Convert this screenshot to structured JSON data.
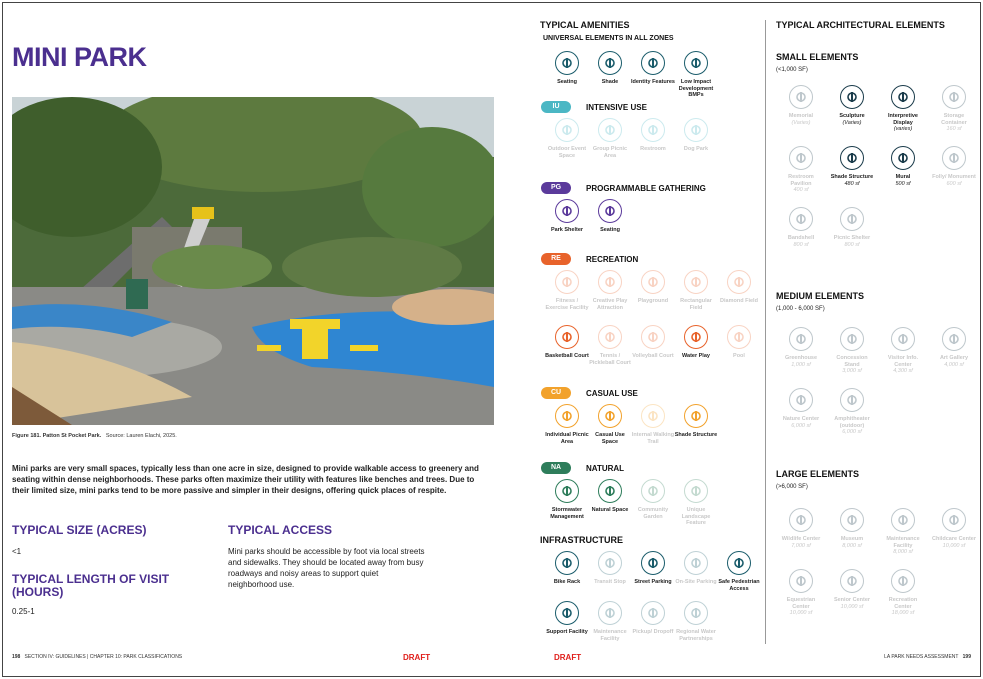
{
  "left": {
    "title": "MINI PARK",
    "caption_bold": "Figure 181.  Patton St Pocket Park.",
    "caption_src": "Source: Lauren Elachi, 2025.",
    "intro": "Mini parks are very small spaces, typically less than one acre in size, designed to provide walkable access to greenery and seating within dense neighborhoods. These parks often maximize their utility with features like benches and trees. Due to their limited size, mini parks tend to be more passive and simpler in their designs, offering quick places of respite.",
    "size_heading": "TYPICAL SIZE (ACRES)",
    "size_value": "<1",
    "visit_heading": "TYPICAL LENGTH OF VISIT (HOURS)",
    "visit_value": "0.25-1",
    "access_heading": "TYPICAL ACCESS",
    "access_text": "Mini parks should be accessible by foot via local streets and sidewalks. They should be located away from busy roadways and noisy areas to support quiet neighborhood use."
  },
  "footer": {
    "left_page": "198",
    "left_text": "SECTION IV: GUIDELINES  |  CHAPTER 10: PARK CLASSIFICATIONS",
    "draft": "DRAFT",
    "right_text": "LA PARK NEEDS ASSESSMENT",
    "right_page": "199"
  },
  "amenities": {
    "heading": "TYPICAL AMENITIES",
    "universal_heading": "UNIVERSAL ELEMENTS IN ALL ZONES",
    "universal_color": "#1a5c6b",
    "universal": [
      {
        "label": "Seating",
        "icon": "bench-icon",
        "active": true
      },
      {
        "label": "Shade",
        "icon": "tree-icon",
        "active": true
      },
      {
        "label": "Identity Features",
        "icon": "badge-icon",
        "active": true
      },
      {
        "label": "Low Impact Development BMPs",
        "icon": "leaf-water-icon",
        "active": true
      }
    ],
    "zones": [
      {
        "code": "IU",
        "name": "INTENSIVE USE",
        "color": "#4bb7c4",
        "items": [
          {
            "label": "Outdoor Event Space",
            "active": false
          },
          {
            "label": "Group Picnic Area",
            "active": false
          },
          {
            "label": "Restroom",
            "active": false
          },
          {
            "label": "Dog Park",
            "active": false
          }
        ]
      },
      {
        "code": "PG",
        "name": "PROGRAMMABLE GATHERING",
        "color": "#5b3a9b",
        "items": [
          {
            "label": "Park Shelter",
            "active": true
          },
          {
            "label": "Seating",
            "active": true
          }
        ]
      },
      {
        "code": "RE",
        "name": "RECREATION",
        "color": "#e8632b",
        "items": [
          {
            "label": "Fitness / Exercise Facility",
            "active": false
          },
          {
            "label": "Creative Play Attraction",
            "active": false
          },
          {
            "label": "Playground",
            "active": false
          },
          {
            "label": "Rectangular Field",
            "active": false
          },
          {
            "label": "Diamond Field",
            "active": false
          },
          {
            "label": "Basketball Court",
            "active": true
          },
          {
            "label": "Tennis / Pickleball Court",
            "active": false
          },
          {
            "label": "Volleyball Court",
            "active": false
          },
          {
            "label": "Water Play",
            "active": true
          },
          {
            "label": "Pool",
            "active": false
          }
        ]
      },
      {
        "code": "CU",
        "name": "CASUAL USE",
        "color": "#f2a22c",
        "items": [
          {
            "label": "Individual Picnic Area",
            "active": true
          },
          {
            "label": "Casual Use Space",
            "active": true
          },
          {
            "label": "Internal Walking Trail",
            "active": false
          },
          {
            "label": "Shade Structure",
            "active": true
          }
        ]
      },
      {
        "code": "NA",
        "name": "NATURAL",
        "color": "#2e7d5b",
        "items": [
          {
            "label": "Stormwater Management",
            "active": true
          },
          {
            "label": "Natural Space",
            "active": true
          },
          {
            "label": "Community Garden",
            "active": false
          },
          {
            "label": "Unique Landscape Feature",
            "active": false
          }
        ]
      }
    ],
    "infra_heading": "INFRASTRUCTURE",
    "infra_color": "#1a5c6b",
    "infrastructure": [
      {
        "label": "Bike Rack",
        "active": true
      },
      {
        "label": "Transit Stop",
        "active": false
      },
      {
        "label": "Street Parking",
        "active": true
      },
      {
        "label": "On-Site Parking",
        "active": false
      },
      {
        "label": "Safe Pedestrian Access",
        "active": true
      },
      {
        "label": "Support Facility",
        "active": true
      },
      {
        "label": "Maintenance Facility",
        "active": false
      },
      {
        "label": "Pickup/ Dropoff",
        "active": false
      },
      {
        "label": "Regional Water Partnerships",
        "active": false
      }
    ]
  },
  "architecture": {
    "heading": "TYPICAL ARCHITECTURAL ELEMENTS",
    "color": "#1a3b4a",
    "small": {
      "heading": "SMALL ELEMENTS",
      "range": "(<1,000 SF)",
      "items": [
        {
          "label": "Memorial",
          "size": "(Varies)",
          "active": false
        },
        {
          "label": "Sculpture",
          "size": "(Varies)",
          "active": true
        },
        {
          "label": "Interpretive Display",
          "size": "(varies)",
          "active": true
        },
        {
          "label": "Storage Container",
          "size": "160 sf",
          "active": false
        },
        {
          "label": "Restroom Pavilion",
          "size": "400 sf",
          "active": false
        },
        {
          "label": "Shade Structure",
          "size": "480 sf",
          "active": true
        },
        {
          "label": "Mural",
          "size": "500 sf",
          "active": true
        },
        {
          "label": "Folly/ Monument",
          "size": "600 sf",
          "active": false
        },
        {
          "label": "Bandshell",
          "size": "800 sf",
          "active": false
        },
        {
          "label": "Picnic Shelter",
          "size": "800 sf",
          "active": false
        }
      ]
    },
    "medium": {
      "heading": "MEDIUM ELEMENTS",
      "range": "(1,000 - 6,000 SF)",
      "items": [
        {
          "label": "Greenhouse",
          "size": "1,000 sf",
          "active": false
        },
        {
          "label": "Concession Stand",
          "size": "3,000 sf",
          "active": false
        },
        {
          "label": "Visitor Info. Center",
          "size": "4,300 sf",
          "active": false
        },
        {
          "label": "Art Gallery",
          "size": "4,000 sf",
          "active": false
        },
        {
          "label": "Nature Center",
          "size": "6,000 sf",
          "active": false
        },
        {
          "label": "Amphitheater (outdoor)",
          "size": "6,000 sf",
          "active": false
        }
      ]
    },
    "large": {
      "heading": "LARGE ELEMENTS",
      "range": "(>6,000 SF)",
      "items": [
        {
          "label": "Wildlife Center",
          "size": "7,000 sf",
          "active": false
        },
        {
          "label": "Museum",
          "size": "8,000 sf",
          "active": false
        },
        {
          "label": "Maintenance Facility",
          "size": "8,000 sf",
          "active": false
        },
        {
          "label": "Childcare Center",
          "size": "10,000 sf",
          "active": false
        },
        {
          "label": "Equestrian Center",
          "size": "10,000 sf",
          "active": false
        },
        {
          "label": "Senior Center",
          "size": "10,000 sf",
          "active": false
        },
        {
          "label": "Recreation Center",
          "size": "18,000 sf",
          "active": false
        }
      ]
    }
  }
}
